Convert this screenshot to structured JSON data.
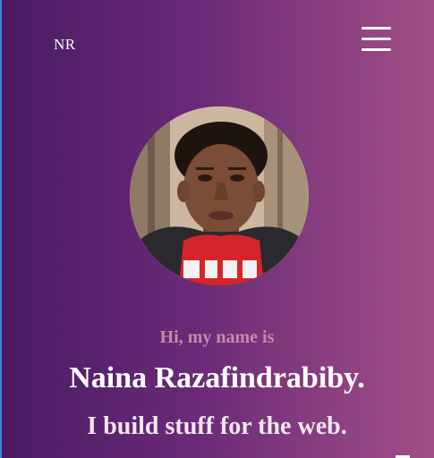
{
  "header": {
    "logo_text": "NR",
    "menu_icon": "hamburger-menu-icon"
  },
  "hero": {
    "avatar_icon": "profile-photo",
    "greeting": "Hi, my name is",
    "name": "Naina Razafindrabiby.",
    "tagline": "I build stuff for the web."
  },
  "colors": {
    "gradient_start": "#4a1a63",
    "gradient_end": "#a24f86",
    "greeting_text": "#c58aa9",
    "heading_text": "#ffffff"
  }
}
